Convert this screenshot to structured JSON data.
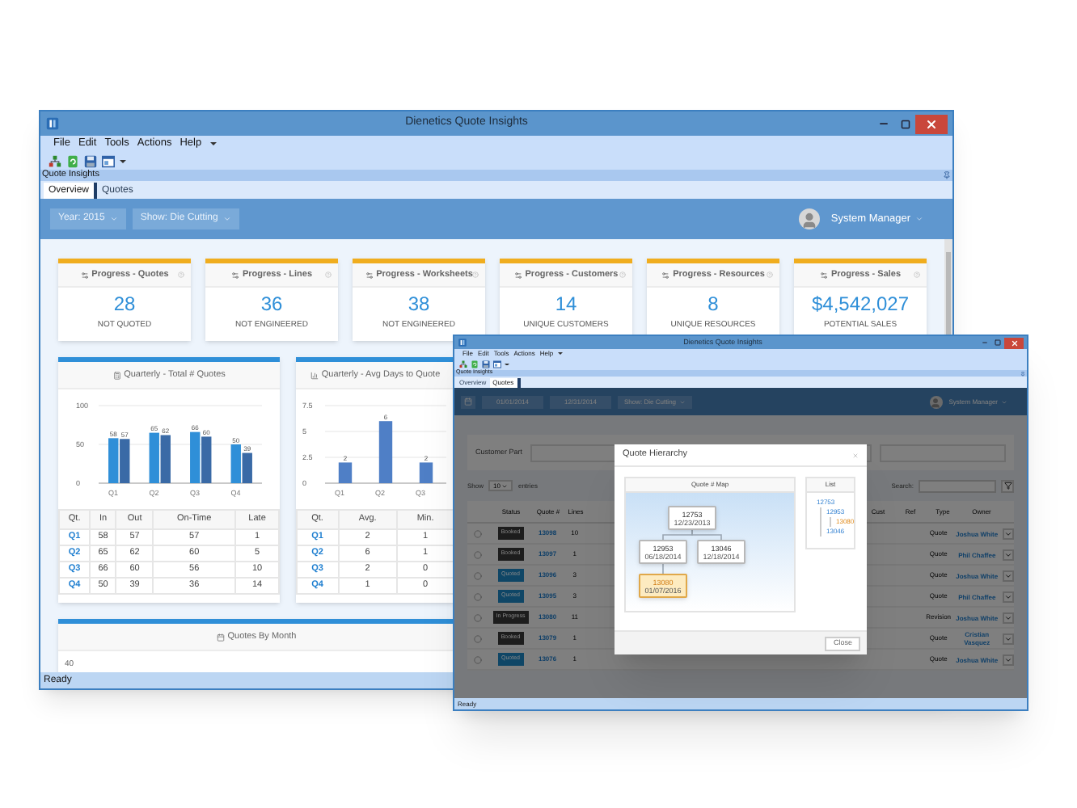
{
  "main_window": {
    "title": "Dienetics Quote Insights",
    "menu": [
      "File",
      "Edit",
      "Tools",
      "Actions",
      "Help"
    ],
    "panel_title": "Quote Insights",
    "tabs": [
      {
        "label": "Overview",
        "selected": true
      },
      {
        "label": "Quotes",
        "selected": false
      }
    ],
    "filters": [
      "Year: 2015",
      "Show: Die Cutting"
    ],
    "user": "System Manager",
    "kpis": [
      {
        "title": "Progress - Quotes",
        "value": "28",
        "label": "NOT QUOTED"
      },
      {
        "title": "Progress - Lines",
        "value": "36",
        "label": "NOT ENGINEERED"
      },
      {
        "title": "Progress - Worksheets",
        "value": "38",
        "label": "NOT ENGINEERED"
      },
      {
        "title": "Progress - Customers",
        "value": "14",
        "label": "UNIQUE CUSTOMERS"
      },
      {
        "title": "Progress - Resources",
        "value": "8",
        "label": "UNIQUE RESOURCES"
      },
      {
        "title": "Progress - Sales",
        "value": "$4,542,027",
        "label": "POTENTIAL SALES"
      }
    ],
    "charts": [
      {
        "title": "Quarterly - Total # Quotes",
        "chart_data": {
          "type": "bar",
          "categories": [
            "Q1",
            "Q2",
            "Q3",
            "Q4"
          ],
          "series": [
            {
              "color": "#2f8fd8",
              "values": [
                58,
                65,
                66,
                50
              ]
            },
            {
              "color": "#3a6aa6",
              "values": [
                57,
                62,
                60,
                39
              ]
            }
          ],
          "ylim": [
            0,
            100
          ],
          "yticks": [
            0,
            50,
            100
          ],
          "grid": true,
          "data_labels": true
        },
        "table": {
          "columns": [
            "Qt.",
            "In",
            "Out",
            "On-Time",
            "Late"
          ],
          "rows": [
            [
              "Q1",
              "58",
              "57",
              "57",
              "1"
            ],
            [
              "Q2",
              "65",
              "62",
              "60",
              "5"
            ],
            [
              "Q3",
              "66",
              "60",
              "56",
              "10"
            ],
            [
              "Q4",
              "50",
              "39",
              "36",
              "14"
            ]
          ]
        }
      },
      {
        "title": "Quarterly - Avg Days to Quote",
        "chart_data": {
          "type": "bar",
          "categories": [
            "Q1",
            "Q2",
            "Q3"
          ],
          "series": [
            {
              "color": "#4f7fc6",
              "values": [
                2,
                6,
                2
              ]
            }
          ],
          "ylim": [
            0,
            7.5
          ],
          "yticks": [
            0,
            2.5,
            5,
            7.5
          ],
          "grid": true,
          "data_labels": true
        },
        "table": {
          "columns": [
            "Qt.",
            "Avg.",
            "Min."
          ],
          "rows": [
            [
              "Q1",
              "2",
              "1"
            ],
            [
              "Q2",
              "6",
              "1"
            ],
            [
              "Q3",
              "2",
              "0"
            ],
            [
              "Q4",
              "1",
              "0"
            ]
          ]
        }
      }
    ],
    "month_panel": {
      "title": "Quotes By Month",
      "y_label": "40"
    },
    "status": "Ready"
  },
  "quotes_window": {
    "title": "Dienetics Quote Insights",
    "menu": [
      "File",
      "Edit",
      "Tools",
      "Actions",
      "Help"
    ],
    "panel_title": "Quote Insights",
    "tabs": [
      {
        "label": "Overview",
        "selected": false
      },
      {
        "label": "Quotes",
        "selected": true
      }
    ],
    "date_from": "01/01/2014",
    "date_to": "12/31/2014",
    "filter": "Show: Die Cutting",
    "user": "System Manager",
    "customer_part_label": "Customer Part",
    "show_label": "Show",
    "page_size": "10",
    "entries_label": "entries",
    "search_label": "Search:",
    "columns": [
      "Status",
      "Quote #",
      "Lines",
      "Cust",
      "Ref",
      "Type",
      "Owner"
    ],
    "rows": [
      {
        "status": "Booked",
        "color": "#1d1d1d",
        "quote": "13098",
        "lines": "10",
        "type": "Quote",
        "owner": "Joshua White"
      },
      {
        "status": "Booked",
        "color": "#1d1d1d",
        "quote": "13097",
        "lines": "1",
        "type": "Quote",
        "owner": "Phil Chaffee"
      },
      {
        "status": "Quoted",
        "color": "#0f4666",
        "quote": "13096",
        "lines": "3",
        "type": "Quote",
        "owner": "Joshua White"
      },
      {
        "status": "Quoted",
        "color": "#0f4666",
        "quote": "13095",
        "lines": "3",
        "type": "Quote",
        "owner": "Phil Chaffee"
      },
      {
        "status": "In Progress",
        "color": "#1d1d1d",
        "quote": "13080",
        "lines": "11",
        "type": "Revision",
        "owner": "Joshua White"
      },
      {
        "status": "Booked",
        "color": "#1d1d1d",
        "quote": "13079",
        "lines": "1",
        "type": "Quote",
        "owner": "Cristian Vasquez"
      },
      {
        "status": "Quoted",
        "color": "#0f4666",
        "quote": "13076",
        "lines": "1",
        "type": "Quote",
        "owner": "Joshua White"
      }
    ],
    "dialog": {
      "title": "Quote Hierarchy",
      "map_title": "Quote # Map",
      "map": {
        "number": "12753",
        "date": "12/23/2013",
        "selected": false,
        "children": [
          {
            "number": "12953",
            "date": "06/18/2014",
            "selected": false,
            "children": [
              {
                "number": "13080",
                "date": "01/07/2016",
                "selected": true
              }
            ]
          },
          {
            "number": "13046",
            "date": "12/18/2014",
            "selected": false
          }
        ]
      },
      "list_title": "List",
      "list": {
        "number": "12753",
        "selected": false,
        "children": [
          {
            "number": "12953",
            "selected": false,
            "children": [
              {
                "number": "13080",
                "selected": true
              }
            ]
          },
          {
            "number": "13046",
            "selected": false
          }
        ]
      },
      "close_label": "Close"
    },
    "status": "Ready"
  }
}
